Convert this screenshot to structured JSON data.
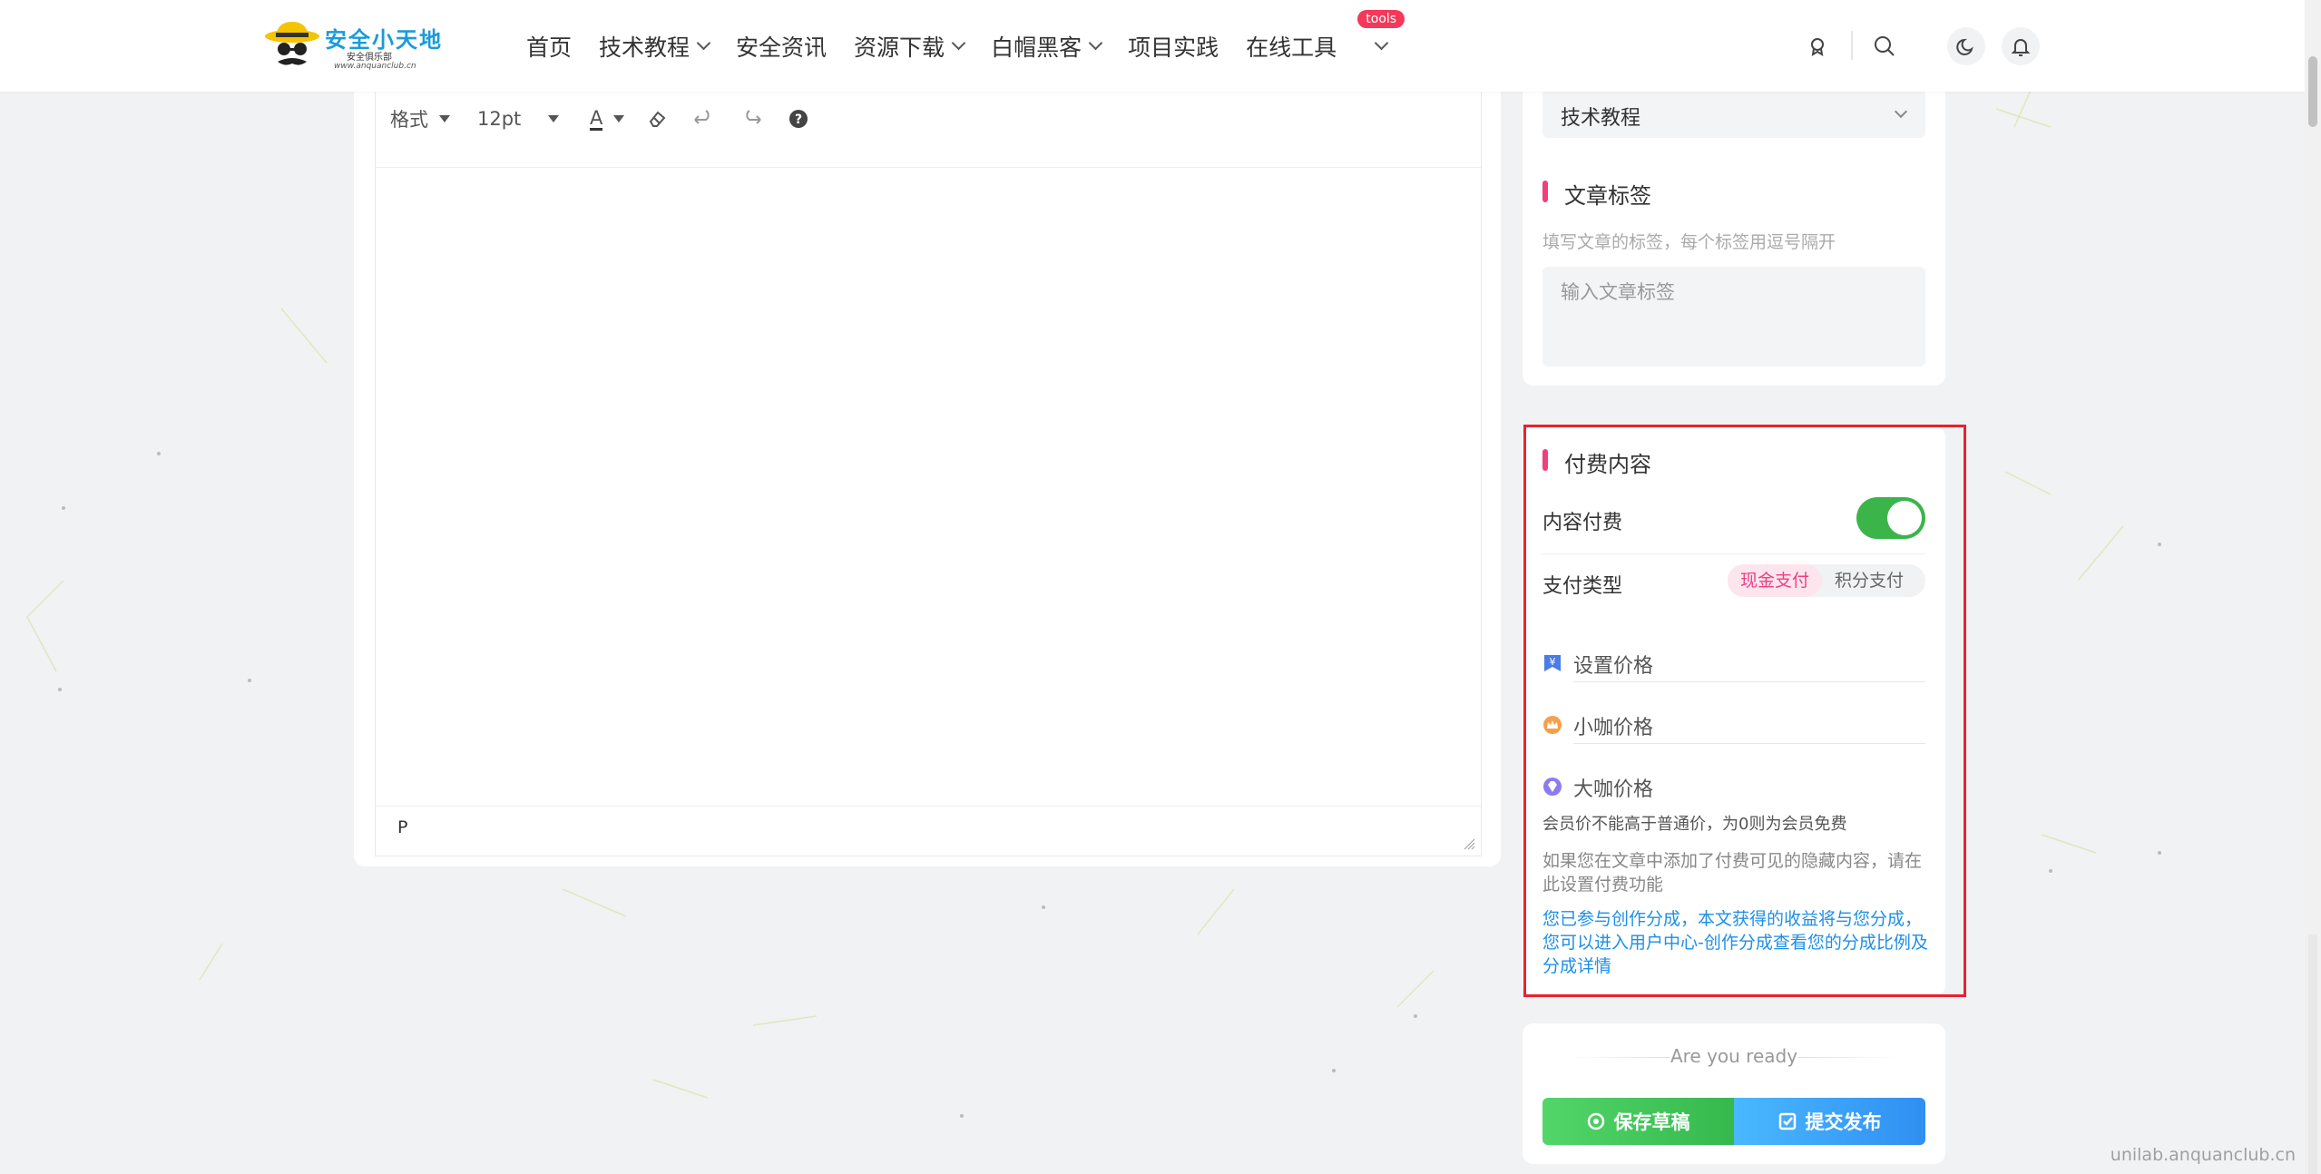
{
  "header": {
    "logo": {
      "title": "安全小天地",
      "subtitle": "安全俱乐部",
      "url": "www.anquanclub.cn"
    },
    "nav": [
      {
        "label": "首页",
        "has_dropdown": false
      },
      {
        "label": "技术教程",
        "has_dropdown": true
      },
      {
        "label": "安全资讯",
        "has_dropdown": false
      },
      {
        "label": "资源下载",
        "has_dropdown": true
      },
      {
        "label": "白帽黑客",
        "has_dropdown": true
      },
      {
        "label": "项目实践",
        "has_dropdown": false
      },
      {
        "label": "在线工具",
        "has_dropdown": true,
        "badge": "tools"
      }
    ],
    "icons": [
      "badge-icon",
      "search-icon",
      "moon-icon",
      "bell-icon"
    ]
  },
  "editor": {
    "toolbar": {
      "format_label": "格式",
      "font_size": "12pt",
      "font_color_label": "A",
      "buttons": [
        "eraser-icon",
        "undo-icon",
        "redo-icon",
        "help-icon"
      ]
    },
    "content": "",
    "status_path": "P"
  },
  "sidebar": {
    "category": {
      "selected": "技术教程"
    },
    "tags": {
      "title": "文章标签",
      "hint": "填写文章的标签，每个标签用逗号隔开",
      "placeholder": "输入文章标签"
    },
    "pay": {
      "title": "付费内容",
      "toggle_label": "内容付费",
      "toggle_on": true,
      "pay_type_label": "支付类型",
      "pay_types": [
        "现金支付",
        "积分支付"
      ],
      "pay_type_selected": "现金支付",
      "price_fields": [
        {
          "label": "设置价格",
          "icon": "yen-ticket-icon"
        },
        {
          "label": "小咖价格",
          "icon": "crown-icon"
        },
        {
          "label": "大咖价格",
          "icon": "diamond-icon"
        }
      ],
      "member_note": "会员价不能高于普通价，为0则为会员免费",
      "hidden_note": "如果您在文章中添加了付费可见的隐藏内容，请在此设置付费功能",
      "share_note": "您已参与创作分成，本文获得的收益将与您分成，您可以进入用户中心-创作分成查看您的分成比例及分成详情"
    },
    "submit": {
      "ready_text": "Are you ready",
      "draft_label": "保存草稿",
      "publish_label": "提交发布"
    }
  },
  "colors": {
    "accent_pink": "#f0407b",
    "toggle_green": "#3bb54a",
    "link_blue": "#1e8fe6",
    "highlight_red": "#e8222e"
  },
  "watermark": "unilab.anquanclub.cn"
}
